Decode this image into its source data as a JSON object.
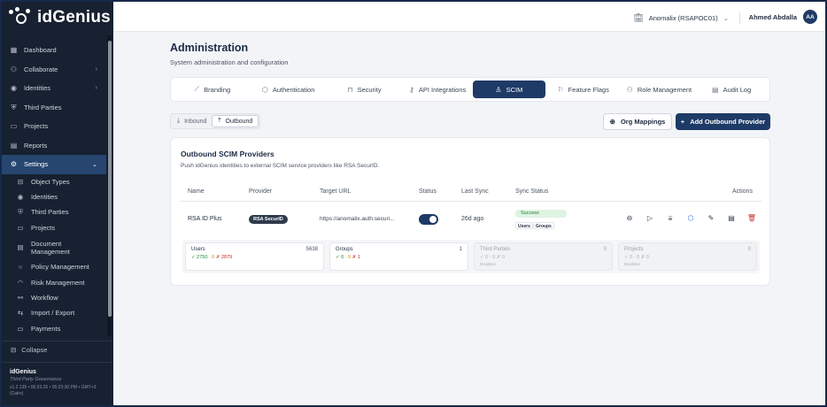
{
  "app": {
    "name": "idGenius",
    "footer_name": "idGenius",
    "tagline": "Third Party Governance",
    "version": "v1.2.135 • 06.03.26 • 05:23:30 PM • GMT+3 (Cairo)"
  },
  "sidebar": {
    "items": [
      {
        "label": "Dashboard",
        "icon": "dashboard-icon"
      },
      {
        "label": "Collaborate",
        "icon": "collaborate-icon",
        "chevron": "›"
      },
      {
        "label": "Identities",
        "icon": "identities-icon",
        "chevron": "›"
      },
      {
        "label": "Third Parties",
        "icon": "third-parties-icon"
      },
      {
        "label": "Projects",
        "icon": "projects-icon"
      },
      {
        "label": "Reports",
        "icon": "reports-icon"
      },
      {
        "label": "Settings",
        "icon": "settings-icon",
        "chevron": "⌄"
      }
    ],
    "sub_items": [
      {
        "label": "Object Types"
      },
      {
        "label": "Identities"
      },
      {
        "label": "Third Parties"
      },
      {
        "label": "Projects"
      },
      {
        "label": "Document Management"
      },
      {
        "label": "Policy Management"
      },
      {
        "label": "Risk Management"
      },
      {
        "label": "Workflow"
      },
      {
        "label": "Import / Export"
      },
      {
        "label": "Payments"
      }
    ],
    "collapse_label": "Collapse"
  },
  "topbar": {
    "org": "Anomalix (RSAPOC01)",
    "user_name": "Ahmed Abdalla",
    "avatar_initials": "AA"
  },
  "page": {
    "title": "Administration",
    "subtitle": "System administration and configuration"
  },
  "tabs": [
    {
      "label": "Branding"
    },
    {
      "label": "Authentication"
    },
    {
      "label": "Security"
    },
    {
      "label": "API Integrations"
    },
    {
      "label": "SCIM",
      "active": true
    },
    {
      "label": "Feature Flags"
    },
    {
      "label": "Role Management"
    },
    {
      "label": "Audit Log"
    }
  ],
  "direction": {
    "inbound": "Inbound",
    "outbound": "Outbound"
  },
  "buttons": {
    "org_mappings": "Org Mappings",
    "add_provider": "Add Outbound Provider"
  },
  "providers_card": {
    "title": "Outbound SCIM Providers",
    "subtitle": "Push idGenius identities to external SCIM service providers like RSA SecurID.",
    "columns": {
      "name": "Name",
      "provider": "Provider",
      "target_url": "Target URL",
      "status": "Status",
      "last_sync": "Last Sync",
      "sync_status": "Sync Status",
      "actions": "Actions"
    },
    "row": {
      "name": "RSA ID Plus",
      "provider": "RSA SecurID",
      "target_url": "https://anomalix.auth.securi...",
      "enabled": true,
      "last_sync": "26d ago",
      "sync_status": "Success",
      "tags": [
        "Users",
        "Groups"
      ]
    },
    "stats": [
      {
        "label": "Users",
        "count": "5638",
        "ok": "✓ 2750",
        "pending": "· 0",
        "failed": "✗ 2879",
        "note": ""
      },
      {
        "label": "Groups",
        "count": "1",
        "ok": "✓ 0",
        "pending": "· 0",
        "failed": "✗ 1",
        "note": ""
      },
      {
        "label": "Third Parties",
        "count": "0",
        "ok": "✓ 0",
        "pending": "· 0",
        "failed": "✗ 0",
        "note": "Disabled"
      },
      {
        "label": "Projects",
        "count": "0",
        "ok": "✓ 0",
        "pending": "· 0",
        "failed": "✗ 0",
        "note": "Disabled"
      }
    ]
  }
}
